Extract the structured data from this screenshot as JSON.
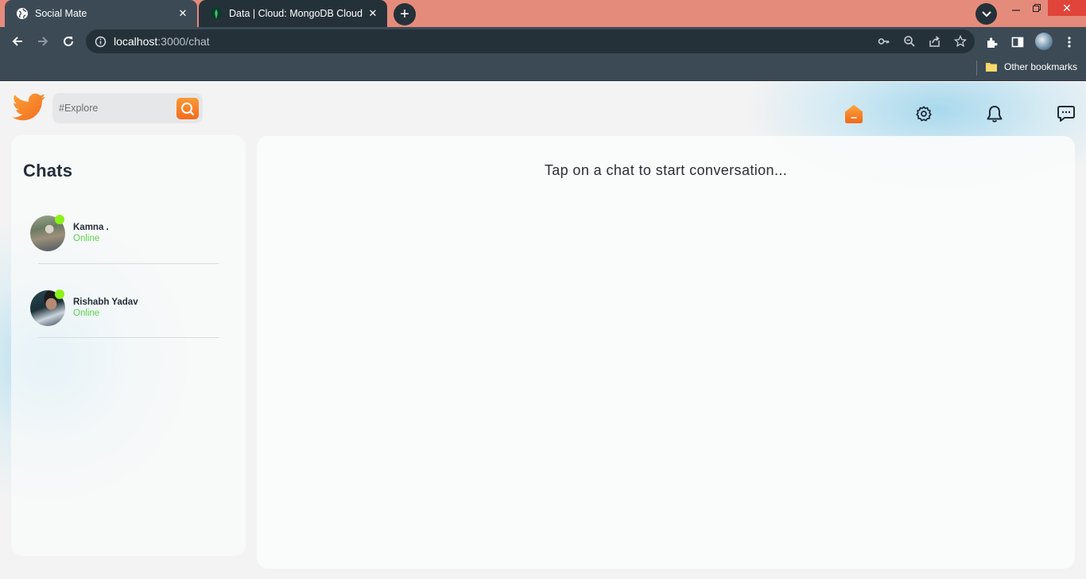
{
  "browser": {
    "tabs": [
      {
        "title": "Social Mate",
        "active": true,
        "favicon": "globe-icon"
      },
      {
        "title": "Data | Cloud: MongoDB Cloud",
        "active": false,
        "favicon": "mongodb-leaf-icon"
      }
    ],
    "url": {
      "host": "localhost",
      "path": ":3000/chat"
    },
    "bookmarks": {
      "other_label": "Other bookmarks"
    },
    "colors": {
      "tabbar": "#e58b7b",
      "toolbar": "#3c4a55",
      "active_tab": "#3c4a55"
    }
  },
  "app": {
    "search": {
      "placeholder": "#Explore"
    },
    "nav_icons": [
      "home-icon",
      "settings-icon",
      "notifications-icon",
      "chat-icon"
    ],
    "colors": {
      "accent": "#f57c1f",
      "online": "#5cd24c",
      "online_dot": "#8cf218"
    }
  },
  "chats": {
    "title": "Chats",
    "items": [
      {
        "name": "Kamna .",
        "status": "Online"
      },
      {
        "name": "Rishabh Yadav",
        "status": "Online"
      }
    ]
  },
  "main": {
    "empty_hint": "Tap on a chat to start conversation..."
  }
}
